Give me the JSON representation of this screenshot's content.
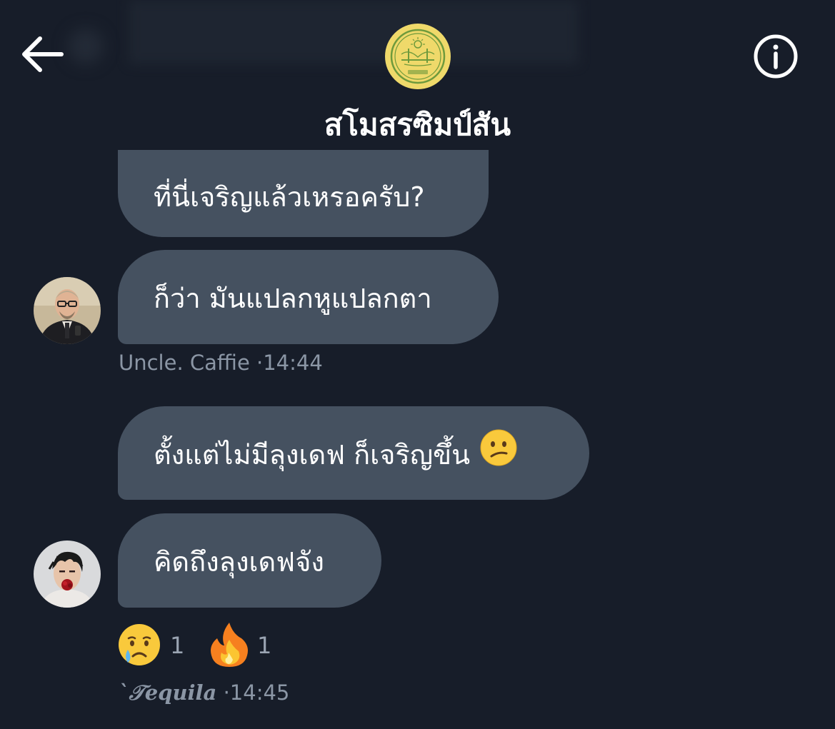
{
  "header": {
    "back_icon": "arrow-left-icon",
    "info_icon": "info-circle-icon",
    "group_logo_icon": "club-seal-logo",
    "title": "สโมสรซิมป์สัน"
  },
  "messages": [
    {
      "text": "ที่นี่เจริญแล้วเหรอครับ?"
    },
    {
      "text": "ก็ว่า มันแปลกหูแปลกตา"
    },
    {
      "text": "ตั้งแต่ไม่มีลุงเดฟ ก็เจริญขึ้น",
      "emoji": "confused-face-emoji"
    },
    {
      "text": "คิดถึงลุงเดฟจัง"
    }
  ],
  "meta": [
    {
      "sender": "Uncle. Caffie",
      "time": "·14:44"
    },
    {
      "sender": "`𝒯equila",
      "time": "·14:45"
    }
  ],
  "reactions": [
    {
      "icon": "crying-face-emoji",
      "count": "1"
    },
    {
      "icon": "fire-emoji",
      "count": "1"
    }
  ],
  "colors": {
    "background": "#171d29",
    "bubble": "#455160",
    "meta_text": "#8b96a5",
    "logo_yellow": "#efd96a",
    "logo_green": "#6e9a3c"
  }
}
